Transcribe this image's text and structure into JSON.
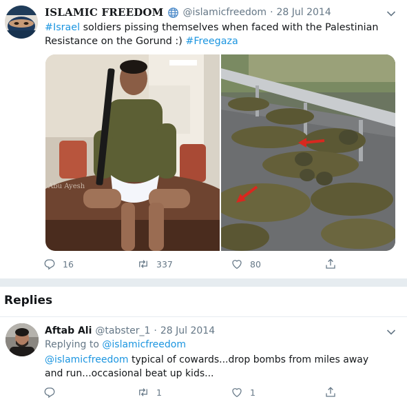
{
  "tweet": {
    "display_name": "ISLAMIC FREEDOM",
    "handle": "@islamicfreedom",
    "separator": "·",
    "date": "28 Jul 2014",
    "text_tag1": "#Israel",
    "text_body": " soldiers pissing themselves when faced with the Palestinian Resistance on the Gorund :) ",
    "text_tag2": "#Freegaza",
    "image_left_watermark": "Abu Ayesh",
    "actions": {
      "reply_count": "16",
      "retweet_count": "337",
      "like_count": "80"
    }
  },
  "replies_heading": "Replies",
  "reply": {
    "display_name": "Aftab Ali",
    "handle": "@tabster_1",
    "separator": "·",
    "date": "28 Jul 2014",
    "replying_prefix": "Replying to ",
    "replying_to": "@islamicfreedom",
    "mention": "@islamicfreedom",
    "text_body": " typical of cowards...drop bombs from miles away and run...occasional beat up kids...",
    "actions": {
      "reply_count": "",
      "retweet_count": "1",
      "like_count": "1"
    }
  },
  "colors": {
    "link": "#1b95e0",
    "muted": "#657786",
    "text": "#14171a",
    "divider": "#e6ecf0"
  },
  "icons": [
    "globe-icon",
    "chevron-down-icon",
    "reply-icon",
    "retweet-icon",
    "like-icon",
    "share-icon"
  ]
}
